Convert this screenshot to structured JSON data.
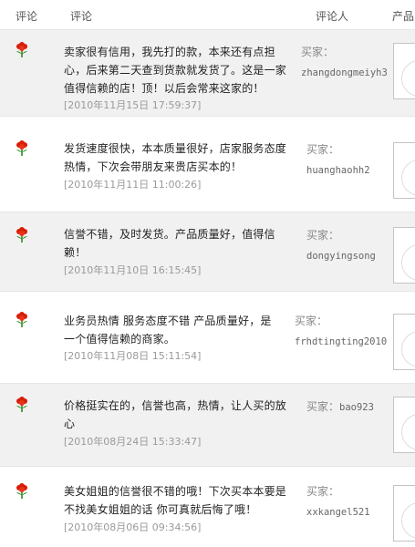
{
  "header": {
    "rating": "评论",
    "comment": "评论",
    "reviewer": "评论人",
    "product": "产品"
  },
  "reviews": [
    {
      "line1": "卖家很有信用，我先打的款，本来还有点担",
      "line2": "心，后来第二天查到货款就发货了。这是一家",
      "line3": "值得信赖的店！顶！以后会常来这家的！",
      "date": "[2010年11月15日 17:59:37]",
      "buyer_label": "买家：",
      "buyer": "zhangdongmeiyh3"
    },
    {
      "line1": "发货速度很快，本本质量很好，店家服务态度",
      "line2": "热情，下次会带朋友来贵店买本的！",
      "date": "[2010年11月11日 11:00:26]",
      "buyer_label": "买家：",
      "buyer": "huanghaohh2"
    },
    {
      "line1": "信誉不错，及时发货。产品质量好，值得信",
      "line2": "赖！",
      "date": "[2010年11月10日 16:15:45]",
      "buyer_label": "买家：",
      "buyer": "dongyingsong"
    },
    {
      "line1": "业务员热情 服务态度不错 产品质量好，是",
      "line2": "一个值得信赖的商家。",
      "date": "[2010年11月08日 15:11:54]",
      "buyer_label": "买家：",
      "buyer": "frhdtingting2010"
    },
    {
      "line1": "价格挺实在的，信誉也高，热情，让人买的放",
      "line2": "心",
      "date": "[2010年08月24日 15:33:47]",
      "buyer_label": "买家：",
      "buyer": "bao923"
    },
    {
      "line1": "美女姐姐的信誉很不错的哦！下次买本本要是",
      "line2": "不找美女姐姐的话 你可真就后悔了哦！",
      "date": "[2010年08月06日 09:34:56]",
      "buyer_label": "买家：",
      "buyer": "xxkangel521"
    }
  ],
  "icons": {
    "rating": "red-flower-icon"
  },
  "colors": {
    "flower": "#d81e06",
    "leaf": "#2e8b22",
    "row_alt": "#f1f1f1"
  }
}
